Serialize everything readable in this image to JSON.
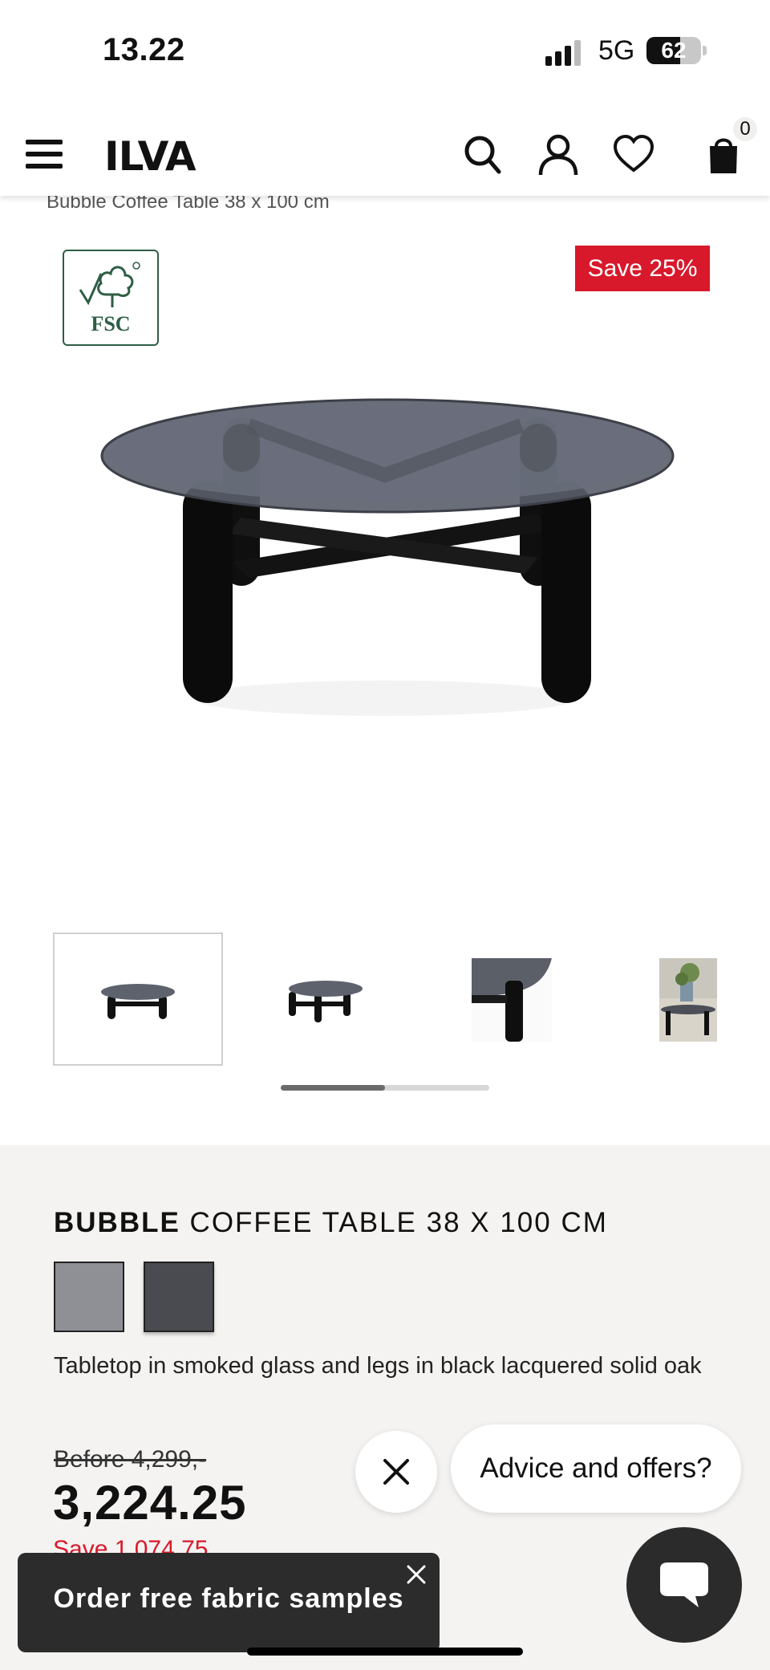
{
  "status_bar": {
    "time": "13.22",
    "network": "5G",
    "battery": "62",
    "battery_level": 0.62
  },
  "header": {
    "logo": "ILVA",
    "cart_count": "0",
    "icons": [
      "menu-icon",
      "search-icon",
      "account-icon",
      "heart-icon",
      "bag-icon"
    ]
  },
  "breadcrumb": "Bubble Coffee Table 38 x 100 cm",
  "gallery": {
    "certification": "FSC",
    "badge": "Save 25%",
    "thumbnail_count": 4,
    "selected_thumbnail": 0,
    "scroll_position": 0.5
  },
  "product": {
    "title_bold": "BUBBLE",
    "title_rest": " COFFEE TABLE 38 X 100 CM",
    "swatches": [
      {
        "color": "#8e9096"
      },
      {
        "color": "#4a4b50"
      }
    ],
    "description": "Tabletop in smoked glass and legs in black lacquered solid oak",
    "before_price": "Before 4,299,-",
    "price": "3,224.25",
    "save_amount": "Save 1,074.75"
  },
  "chat": {
    "prompt": "Advice and offers?"
  },
  "toast": {
    "label": "Order free fabric samples"
  },
  "colors": {
    "accent_red": "#d8192b",
    "panel_bg": "#f4f3f1",
    "fsc_green": "#2e5e45"
  }
}
